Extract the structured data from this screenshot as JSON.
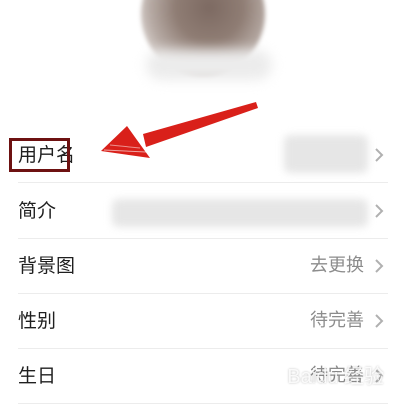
{
  "profile": {
    "rows": [
      {
        "label": "用户名",
        "value": ""
      },
      {
        "label": "简介",
        "value": ""
      },
      {
        "label": "背景图",
        "value": "去更换"
      },
      {
        "label": "性别",
        "value": "待完善"
      },
      {
        "label": "生日",
        "value": "待完善"
      }
    ]
  },
  "icons": {
    "row_arrow": "chevron-right-icon",
    "annotation": "red-arrow-annotation"
  },
  "colors": {
    "annotation_red": "#d9201a",
    "box_border": "#6d1111",
    "value_gray": "#8c8c8c"
  }
}
